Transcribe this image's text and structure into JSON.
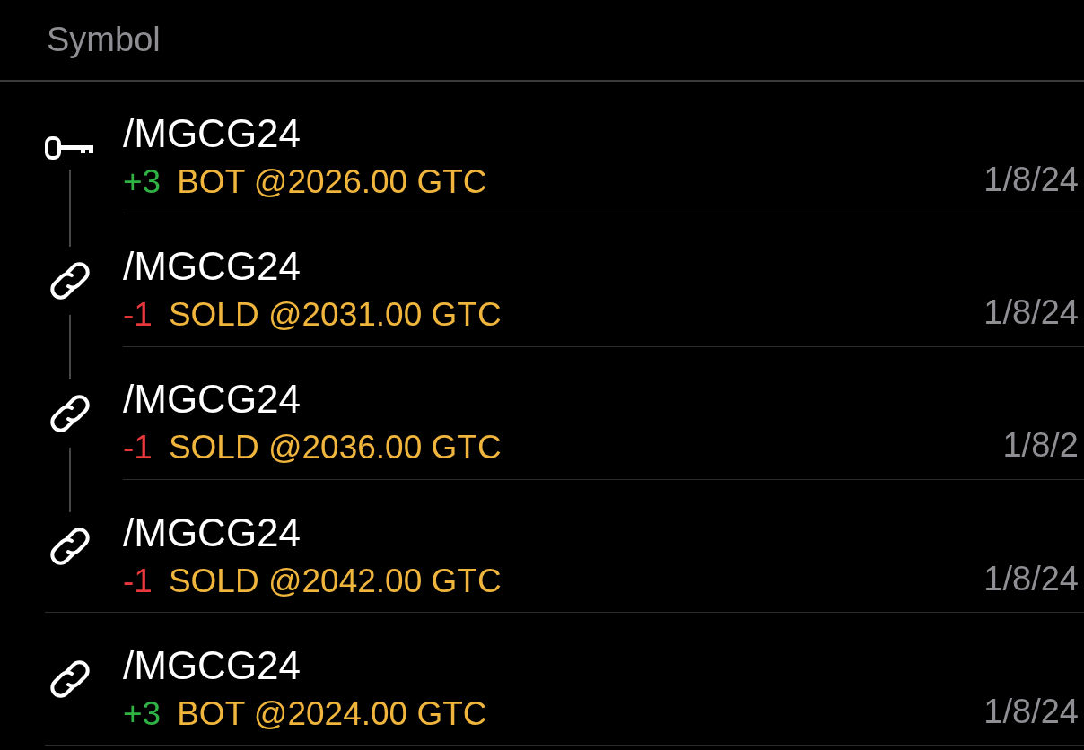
{
  "header": {
    "column": "Symbol"
  },
  "orders": [
    {
      "kind": "key",
      "symbol": "/MGCG24",
      "qty": "+3",
      "color": "#2fb344",
      "action": "BOT",
      "price": "@2026.00",
      "tif": "GTC",
      "date": "1/8/24",
      "linked_to_next": true
    },
    {
      "kind": "link",
      "symbol": "/MGCG24",
      "qty": "-1",
      "color": "#e8383b",
      "action": "SOLD",
      "price": "@2031.00",
      "tif": "GTC",
      "date": "1/8/24",
      "linked_to_next": true
    },
    {
      "kind": "link",
      "symbol": "/MGCG24",
      "qty": "-1",
      "color": "#e8383b",
      "action": "SOLD",
      "price": "@2036.00",
      "tif": "GTC",
      "date": "1/8/2",
      "linked_to_next": true
    },
    {
      "kind": "link",
      "symbol": "/MGCG24",
      "qty": "-1",
      "color": "#e8383b",
      "action": "SOLD",
      "price": "@2042.00",
      "tif": "GTC",
      "date": "1/8/24",
      "linked_to_next": false
    },
    {
      "kind": "link",
      "symbol": "/MGCG24",
      "qty": "+3",
      "color": "#2fb344",
      "action": "BOT",
      "price": "@2024.00",
      "tif": "GTC",
      "date": "1/8/24",
      "linked_to_next": false
    }
  ]
}
